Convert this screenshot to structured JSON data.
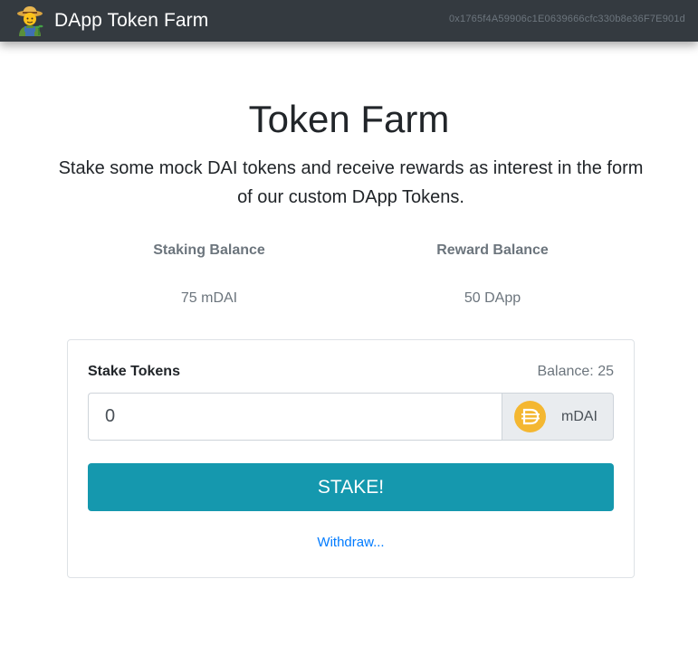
{
  "navbar": {
    "brand_icon": "farmer-icon",
    "brand": "DApp Token Farm",
    "account": "0x1765f4A59906c1E0639666cfc330b8e36F7E901d"
  },
  "main": {
    "title": "Token Farm",
    "lead": "Stake some mock DAI tokens and receive rewards as interest in the form of our custom DApp Tokens.",
    "balances": {
      "staking_label": "Staking Balance",
      "staking_value": "75 mDAI",
      "reward_label": "Reward Balance",
      "reward_value": "50 DApp"
    }
  },
  "stake_card": {
    "label": "Stake Tokens",
    "balance": "Balance: 25",
    "input_value": "0",
    "token_icon": "dai-icon",
    "token_label": "mDAI",
    "stake_button": "STAKE!",
    "withdraw_link": "Withdraw..."
  },
  "colors": {
    "navbar_bg": "#343a40",
    "stake_button": "#1598ae",
    "link": "#007bff",
    "dai_orange": "#f4b731"
  }
}
